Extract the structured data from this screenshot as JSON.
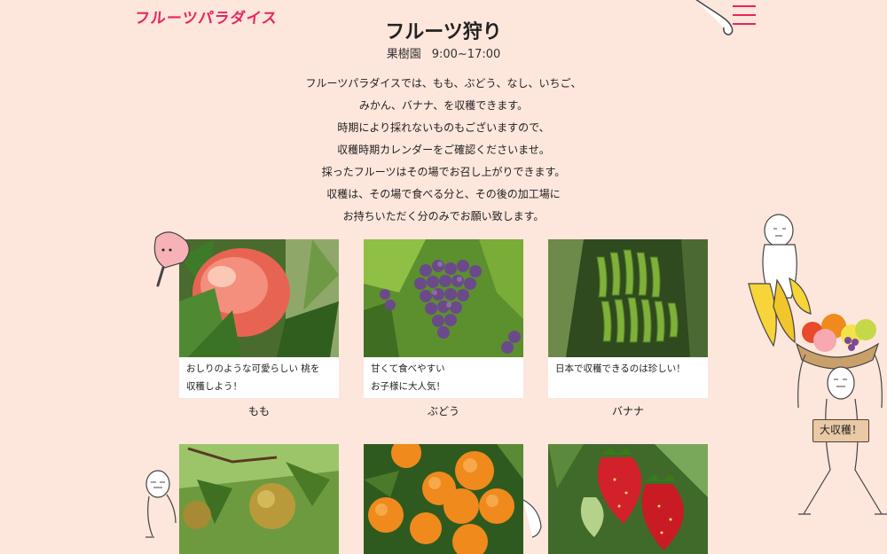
{
  "header": {
    "logo": "フルーツパラダイス",
    "menu_icon": "hamburger-menu-icon"
  },
  "page": {
    "title": "フルーツ狩り",
    "hours_label": "果樹園",
    "hours_value": "9:00~17:00"
  },
  "intro": [
    "フルーツパラダイスでは、もも、ぶどう、なし、いちご、",
    "みかん、バナナ、を収穫できます。",
    "時期により採れないものもございますので、",
    "収穫時期カレンダーをご確認くださいませ。",
    "採ったフルーツはその場でお召し上がりできます。",
    "収穫は、その場で食べる分と、その後の加工場に",
    "お持ちいただく分のみでお願い致します。"
  ],
  "fruits": [
    {
      "name": "もも",
      "caption_1": "おしりのような可愛らしい 桃を",
      "caption_2": "収穫しよう！"
    },
    {
      "name": "ぶどう",
      "caption_1": "甘くて食べやすい",
      "caption_2": "お子様に大人気！"
    },
    {
      "name": "バナナ",
      "caption_1": "日本で収穫できるのは珍しい！",
      "caption_2": ""
    },
    {
      "name": "なし"
    },
    {
      "name": "みかん"
    },
    {
      "name": "いちご"
    }
  ],
  "decor": {
    "sign_text": "大収穫！"
  },
  "colors": {
    "background": "#fde6dc",
    "accent": "#e8245e"
  }
}
